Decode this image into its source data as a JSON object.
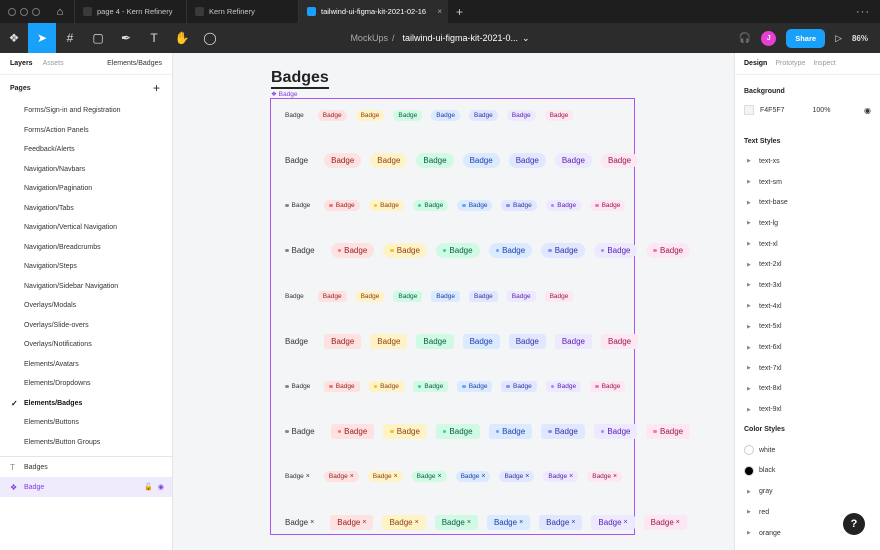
{
  "tabs": [
    {
      "label": "page 4 - Kern Refinery",
      "active": false
    },
    {
      "label": "Kern Refinery",
      "active": false
    },
    {
      "label": "tailwind-ui-figma-kit-2021-02-16",
      "active": true
    }
  ],
  "toolbar": {
    "project": "MockUps",
    "separator": "/",
    "file": "tailwind-ui-figma-kit-2021-0...",
    "chevron": "⌄",
    "avatar_initial": "J",
    "share_label": "Share",
    "zoom": "86%"
  },
  "left_panel": {
    "tab_layers": "Layers",
    "tab_assets": "Assets",
    "page_selector": "Elements/Badges",
    "pages_title": "Pages",
    "add": "+",
    "pages": [
      "Forms/Sign-in and Registration",
      "Forms/Action Panels",
      "Feedback/Alerts",
      "Navigation/Navbars",
      "Navigation/Pagination",
      "Navigation/Tabs",
      "Navigation/Vertical Navigation",
      "Navigation/Breadcrumbs",
      "Navigation/Steps",
      "Navigation/Sidebar Navigation",
      "Overlays/Modals",
      "Overlays/Slide-overs",
      "Overlays/Notifications",
      "Elements/Avatars",
      "Elements/Dropdowns",
      "Elements/Badges",
      "Elements/Buttons",
      "Elements/Button Groups"
    ],
    "current_page_index": 15,
    "layers": [
      {
        "label": "Badges",
        "icon": "text-icon",
        "selected": false
      },
      {
        "label": "Badge",
        "icon": "component-icon",
        "selected": true
      }
    ]
  },
  "canvas": {
    "title": "Badges",
    "frame_label": "❖ Badge",
    "badge_text": "Badge",
    "close_glyph": "×",
    "rows": [
      {
        "size": "sm",
        "dot": false,
        "remove": false,
        "shape": "pill"
      },
      {
        "size": "lg",
        "dot": false,
        "remove": false,
        "shape": "pill"
      },
      {
        "size": "sm",
        "dot": true,
        "remove": false,
        "shape": "pill"
      },
      {
        "size": "lg",
        "dot": true,
        "remove": false,
        "shape": "pill"
      },
      {
        "size": "sm",
        "dot": false,
        "remove": false,
        "shape": "rounded"
      },
      {
        "size": "lg",
        "dot": false,
        "remove": false,
        "shape": "rounded"
      },
      {
        "size": "sm",
        "dot": true,
        "remove": false,
        "shape": "rounded"
      },
      {
        "size": "lg",
        "dot": true,
        "remove": false,
        "shape": "rounded"
      },
      {
        "size": "sm",
        "dot": false,
        "remove": true,
        "shape": "pill"
      },
      {
        "size": "lg",
        "dot": false,
        "remove": true,
        "shape": "rounded"
      }
    ],
    "colors": [
      "gray",
      "red",
      "yellow",
      "green",
      "blue",
      "indigo",
      "purple",
      "pink"
    ]
  },
  "right_panel": {
    "tab_design": "Design",
    "tab_prototype": "Prototype",
    "tab_inspect": "Inspect",
    "background_title": "Background",
    "background_hex": "F4F5F7",
    "background_opacity": "100%",
    "text_styles_title": "Text Styles",
    "text_styles": [
      "text-xs",
      "text-sm",
      "text-base",
      "text-lg",
      "text-xl",
      "text-2xl",
      "text-3xl",
      "text-4xl",
      "text-5xl",
      "text-6xl",
      "text-7xl",
      "text-8xl",
      "text-9xl"
    ],
    "color_styles_title": "Color Styles",
    "color_styles": [
      {
        "label": "white",
        "swatch": "#ffffff"
      },
      {
        "label": "black",
        "swatch": "#000000"
      },
      {
        "label": "gray",
        "swatch": ""
      },
      {
        "label": "red",
        "swatch": ""
      },
      {
        "label": "orange",
        "swatch": ""
      }
    ]
  },
  "help": "?"
}
